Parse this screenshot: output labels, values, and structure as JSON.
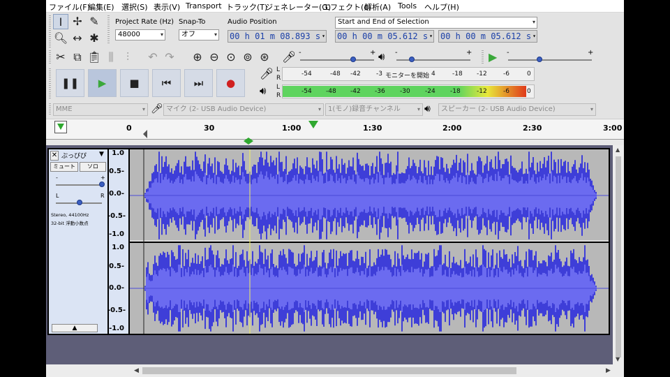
{
  "menu": [
    "ファイル(F)",
    "編集(E)",
    "選択(S)",
    "表示(V)",
    "Transport",
    "トラック(T)",
    "ジェネレーター(G)",
    "エフェクト(c)",
    "解析(A)",
    "Tools",
    "ヘルプ(H)"
  ],
  "project_rate": {
    "label": "Project Rate (Hz)",
    "value": "48000"
  },
  "snap_to": {
    "label": "Snap-To",
    "value": "オフ"
  },
  "audio_position": {
    "label": "Audio Position",
    "value": "00 h 01 m 08.893 s"
  },
  "selection": {
    "label": "Start and End of Selection",
    "start": "00 h 00 m 05.612 s",
    "end": "00 h 00 m 05.612 s"
  },
  "meters": {
    "record_ticks": [
      "-54",
      "-48",
      "-42",
      "-3",
      "モニターを開始",
      "4",
      "-18",
      "-12",
      "-6",
      "0"
    ],
    "play_ticks": [
      "-54",
      "-48",
      "-42",
      "-36",
      "-30",
      "-24",
      "-18",
      "-12",
      "-6",
      "0"
    ],
    "play_level_fraction": 0.97
  },
  "devices": {
    "host": "MME",
    "mic": "マイク (2- USB Audio Device)",
    "channels": "1(モノ)録音チャンネル",
    "speaker": "スピーカー (2- USB Audio Device)"
  },
  "ruler": {
    "labels": [
      "0",
      "30",
      "1:00",
      "1:30",
      "2:00",
      "2:30",
      "3:00"
    ]
  },
  "track": {
    "name": "ぶっぴぴ",
    "mute": "ミュート",
    "solo": "ソロ",
    "gain_minus": "-",
    "gain_plus": "+",
    "pan_left": "L",
    "pan_right": "R",
    "info1": "Stereo, 44100Hz",
    "info2": "32-bit 浮動小数点",
    "scale": [
      "1.0",
      "0.5-",
      "0.0-",
      "-0.5-",
      "-1.0"
    ]
  },
  "colors": {
    "waveform": "#3e3ed8",
    "waveform_rms": "#6b6bf0",
    "track_bg": "#b8b8b8",
    "selected_tcp": "#dbe4f4",
    "play_meter": [
      "#5fd45f",
      "#e8e83a",
      "#e03a1a"
    ]
  }
}
